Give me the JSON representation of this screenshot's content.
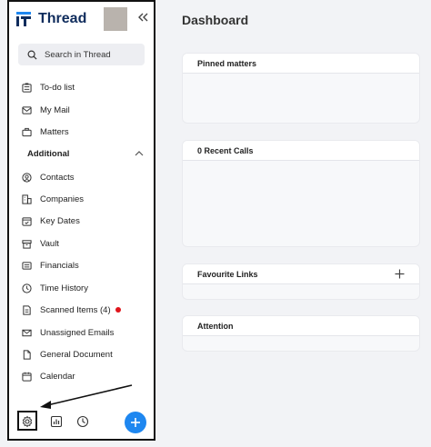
{
  "brand": {
    "name": "Thread"
  },
  "search": {
    "placeholder": "Search in Thread"
  },
  "nav": {
    "primary": [
      {
        "label": "To-do list",
        "icon": "todo-list-icon"
      },
      {
        "label": "My Mail",
        "icon": "mail-icon"
      },
      {
        "label": "Matters",
        "icon": "briefcase-icon"
      }
    ],
    "section_title": "Additional",
    "additional": [
      {
        "label": "Contacts",
        "icon": "contact-icon"
      },
      {
        "label": "Companies",
        "icon": "building-icon"
      },
      {
        "label": "Key Dates",
        "icon": "calendar-check-icon"
      },
      {
        "label": "Vault",
        "icon": "vault-icon"
      },
      {
        "label": "Financials",
        "icon": "financials-icon"
      },
      {
        "label": "Time History",
        "icon": "clock-icon"
      },
      {
        "label": "Scanned Items (4)",
        "icon": "document-icon",
        "badge": "red-dot"
      },
      {
        "label": "Unassigned Emails",
        "icon": "envelope-icon"
      },
      {
        "label": "General Document",
        "icon": "file-icon"
      },
      {
        "label": "Calendar",
        "icon": "calendar-icon"
      }
    ]
  },
  "main": {
    "title": "Dashboard",
    "cards": [
      {
        "title": "Pinned matters"
      },
      {
        "title": "0 Recent Calls"
      },
      {
        "title": "Favourite Links"
      },
      {
        "title": "Attention"
      }
    ]
  },
  "colors": {
    "accent": "#1e87f0",
    "brand": "#0f2c5c",
    "badge": "#e0141b"
  }
}
